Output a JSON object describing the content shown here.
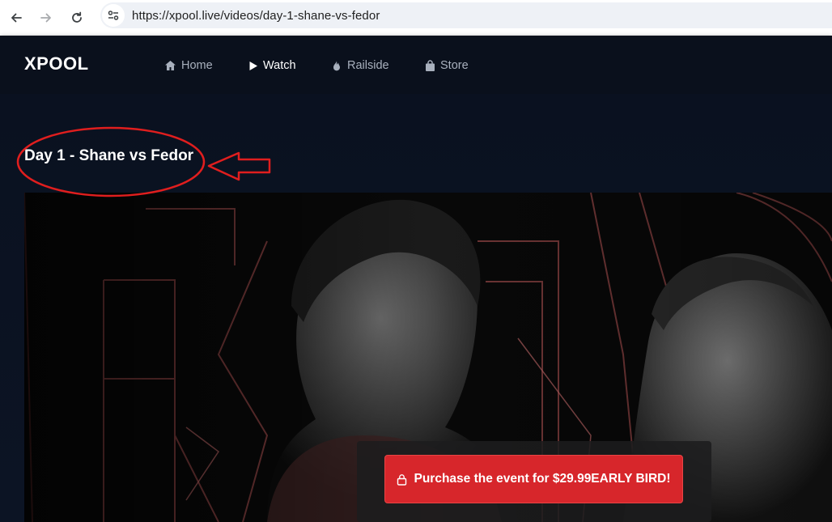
{
  "browser": {
    "url": "https://xpool.live/videos/day-1-shane-vs-fedor",
    "back_icon": "arrow-left-icon",
    "forward_icon": "arrow-right-icon",
    "reload_icon": "reload-icon",
    "site_info_icon": "tune-icon"
  },
  "header": {
    "logo": "XPOOL",
    "menu": [
      {
        "label": "Home",
        "icon": "home-icon",
        "active": false
      },
      {
        "label": "Watch",
        "icon": "play-icon",
        "active": true
      },
      {
        "label": "Railside",
        "icon": "flame-icon",
        "active": false
      },
      {
        "label": "Store",
        "icon": "shopping-bag-icon",
        "active": false
      }
    ]
  },
  "page": {
    "title": "Day 1 - Shane vs Fedor"
  },
  "video": {
    "purchase_label": "Purchase the event for $29.99EARLY BIRD!",
    "purchase_icon": "lock-icon"
  },
  "colors": {
    "background": "#0b1220",
    "header": "#0a101c",
    "accent_red": "#d7262b",
    "annotation_red": "#e01e1e"
  }
}
